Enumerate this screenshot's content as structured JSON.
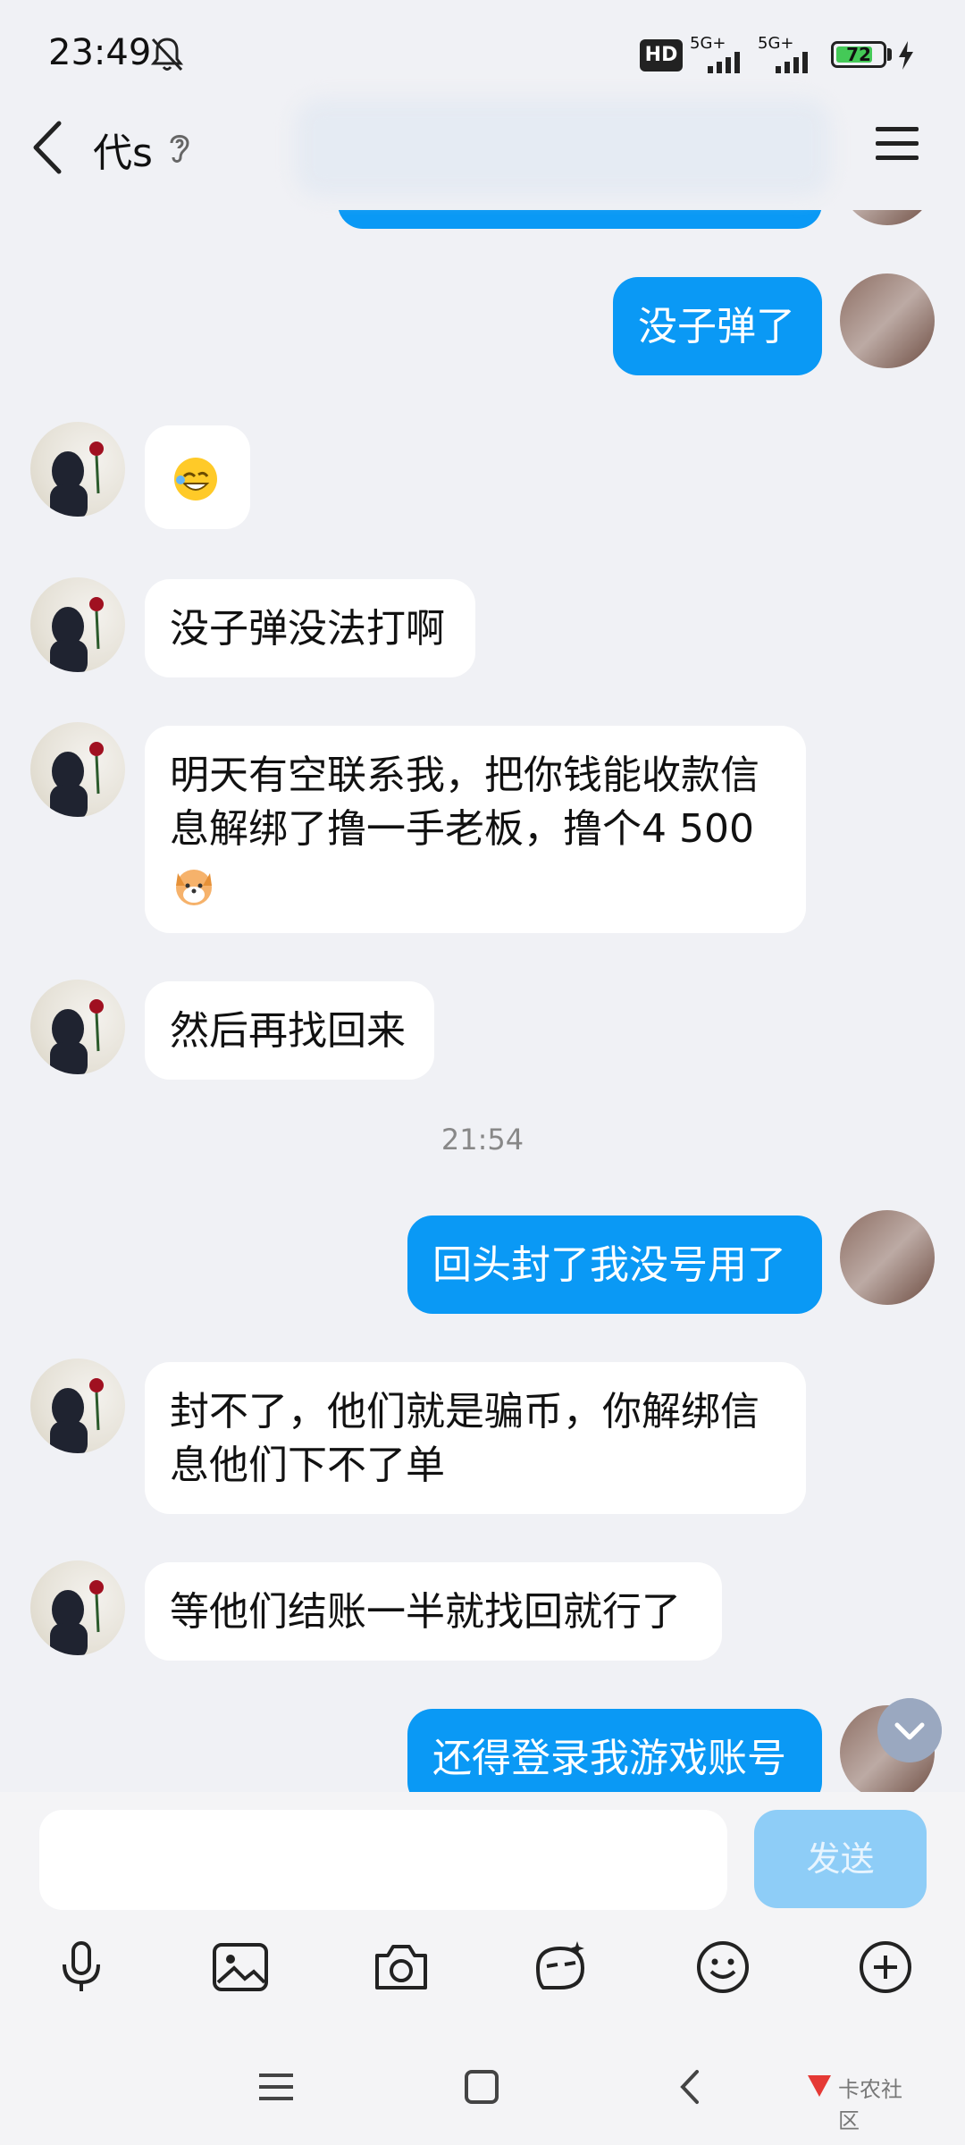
{
  "status_bar": {
    "time": "23:49",
    "hd_label": "HD",
    "signal_1": "5G+",
    "signal_2": "5G+",
    "battery": "72"
  },
  "header": {
    "title": "代s"
  },
  "messages": [
    {
      "from": "other",
      "text": ""
    },
    {
      "from": "other",
      "text": "没子弹没法打啊"
    },
    {
      "from": "other",
      "line1": "明天有空联系我，把你钱能收款信",
      "line2": "息解绑了撸一手老板，撸个4  500"
    },
    {
      "from": "other",
      "text": "然后再找回来"
    },
    {
      "from": "me",
      "text": "回头封了我没号用了"
    },
    {
      "from": "other",
      "line1": "封不了，他们就是骗币，你解绑信",
      "line2": "息他们下不了单"
    },
    {
      "from": "other",
      "text": "等他们结账一半就找回就行了"
    },
    {
      "from": "me",
      "text": "还得登录我游戏账号"
    }
  ],
  "top_message": {
    "text": "没子弹了"
  },
  "timestamp": "21:54",
  "input": {
    "placeholder": "",
    "send_label": "发送"
  },
  "toolbar": [
    "mic-icon",
    "image-icon",
    "camera-icon",
    "sticker-icon",
    "emoji-icon",
    "plus-icon"
  ],
  "watermark": "卡农社区",
  "colors": {
    "my_bubble": "#0a99f5",
    "other_bubble": "#ffffff",
    "background": "#f0f1f5",
    "send_disabled": "#8ecdf7"
  }
}
